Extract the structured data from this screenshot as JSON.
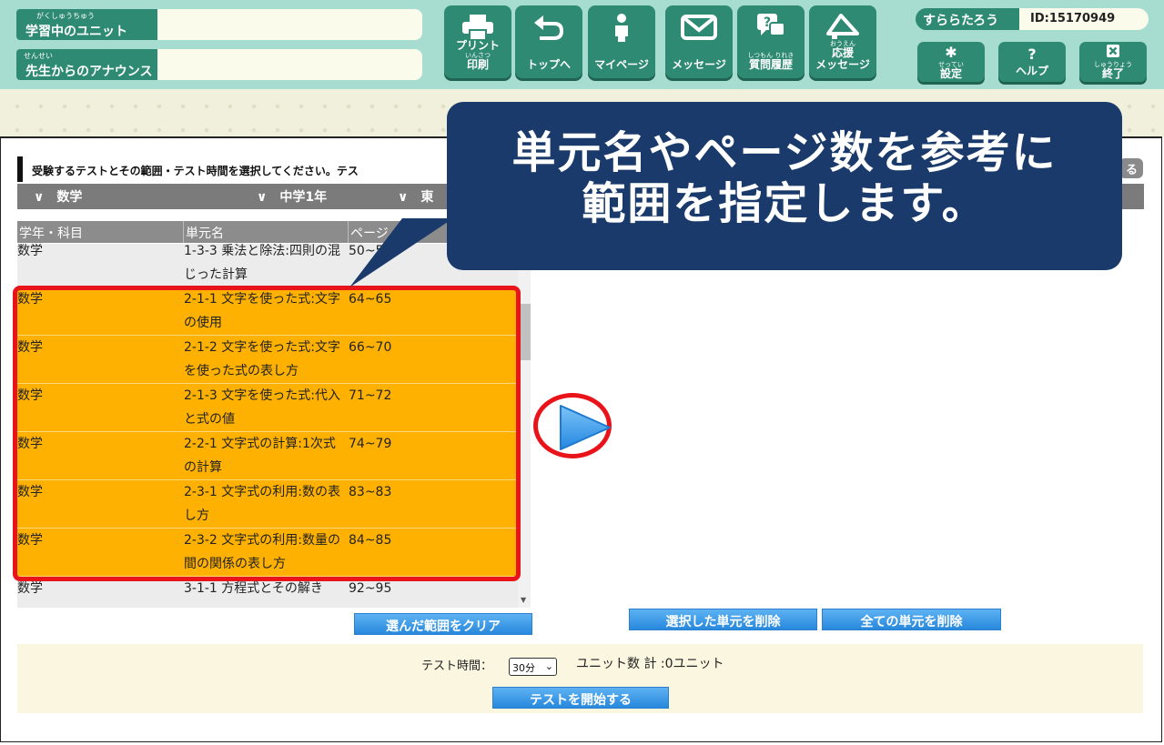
{
  "header": {
    "learning_unit_label": "学習中のユニット",
    "learning_unit_ruby": "がくしゅうちゅう",
    "learning_unit_value": "",
    "announce_label": "先生からのアナウンス",
    "announce_ruby": "せんせい",
    "announce_value": "",
    "nav": [
      {
        "label": "プリント",
        "label2": "印刷",
        "ruby": "いんさつ",
        "icon": "printer-icon"
      },
      {
        "label": "トップへ",
        "icon": "return-arrow-icon"
      },
      {
        "label": "マイページ",
        "icon": "person-icon"
      },
      {
        "label": "メッセージ",
        "icon": "envelope-icon"
      },
      {
        "label": "質問履歴",
        "ruby": "しつもん りれき",
        "icon": "question-bubble-icon"
      },
      {
        "label": "応援",
        "label2": "メッセージ",
        "ruby": "おうえん",
        "icon": "megaphone-icon"
      }
    ],
    "user_name": "すららたろう",
    "user_id": "ID:15170949",
    "settings_label": "設定",
    "settings_ruby": "せってい",
    "help_label": "ヘルプ",
    "exit_label": "終了",
    "exit_ruby": "しゅうりょう"
  },
  "main": {
    "instruction": "受験するテストとその範囲・テスト時間を選択してください。テス",
    "right_pill": "る",
    "filters": [
      "数学",
      "中学1年",
      "東"
    ],
    "columns": [
      "学年・科目",
      "単元名",
      "ページ"
    ],
    "rows": [
      {
        "subject": "数学",
        "unit": "1-3-3 乗法と除法:四則の混じった計算",
        "pages": "50~51",
        "selected": false
      },
      {
        "subject": "数学",
        "unit": "2-1-1 文字を使った式:文字の使用",
        "pages": "64~65",
        "selected": true
      },
      {
        "subject": "数学",
        "unit": "2-1-2 文字を使った式:文字を使った式の表し方",
        "pages": "66~70",
        "selected": true
      },
      {
        "subject": "数学",
        "unit": "2-1-3 文字を使った式:代入と式の値",
        "pages": "71~72",
        "selected": true
      },
      {
        "subject": "数学",
        "unit": "2-2-1 文字式の計算:1次式の計算",
        "pages": "74~79",
        "selected": true
      },
      {
        "subject": "数学",
        "unit": "2-3-1 文字式の利用:数の表し方",
        "pages": "83~83",
        "selected": true
      },
      {
        "subject": "数学",
        "unit": "2-3-2 文字式の利用:数量の間の関係の表し方",
        "pages": "84~85",
        "selected": true
      },
      {
        "subject": "数学",
        "unit": "3-1-1 方程式とその解き",
        "pages": "92~95",
        "selected": false
      }
    ],
    "clear_button": "選んだ範囲をクリア",
    "delete_selected_button": "選択した単元を削除",
    "delete_all_button": "全ての単元を削除",
    "test_time_label": "テスト時間：",
    "test_time_value": "30分",
    "unit_count": "ユニット数 計 :0ユニット",
    "start_button": "テストを開始する"
  },
  "callout": {
    "line1": "単元名やページ数を参考に",
    "line2": "範囲を指定します。"
  },
  "colors": {
    "header_bg": "#a6ddd0",
    "header_btn": "#2f8a73",
    "selected_row": "#feb101",
    "highlight_red": "#e8141a",
    "callout_bg": "#1a3a6b",
    "blue_button": "#2788dd"
  }
}
